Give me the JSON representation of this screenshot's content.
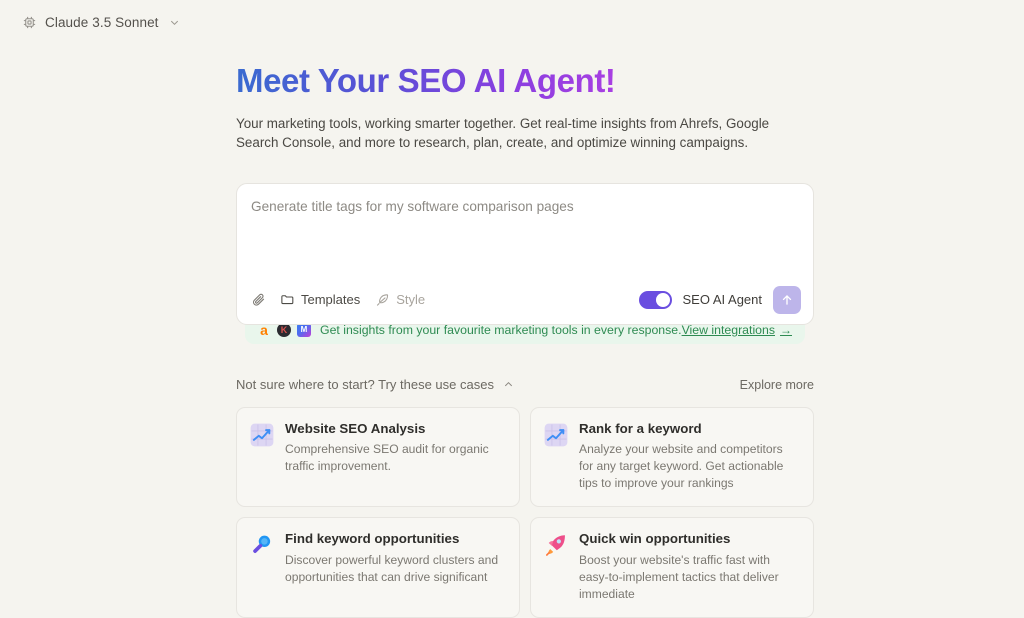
{
  "topbar": {
    "model_name": "Claude 3.5 Sonnet",
    "chip_icon": "chip-icon",
    "chevron_icon": "chevron-down-icon"
  },
  "hero": {
    "headline": "Meet Your SEO AI Agent!",
    "subtitle": "Your marketing tools, working smarter together. Get real-time insights from Ahrefs, Google Search Console, and more to research, plan, create, and optimize winning campaigns.",
    "gradient_start": "#3a6bd0",
    "gradient_end": "#a93fe2"
  },
  "composer": {
    "placeholder": "Generate title tags for my software comparison pages",
    "value": "",
    "attach_icon": "paperclip-icon",
    "templates_label": "Templates",
    "templates_icon": "folder-icon",
    "style_label": "Style",
    "style_icon": "feather-icon",
    "agent_toggle_label": "SEO AI Agent",
    "agent_toggle_on": true,
    "toggle_color": "#6a4ee0",
    "send_icon": "arrow-up-icon",
    "send_button_color": "#bdb5ea"
  },
  "integrations": {
    "text": "Get insights from your favourite marketing tools in every response.",
    "link_label": "View integrations",
    "link_arrow": "→",
    "accent_color": "#2e8b52",
    "background_color": "#e9f6ec",
    "icons": [
      {
        "name": "ahrefs-icon",
        "glyph": "a"
      },
      {
        "name": "google-search-console-icon",
        "glyph": "K"
      },
      {
        "name": "marketing-tool-icon",
        "glyph": "M"
      }
    ]
  },
  "usecases": {
    "title": "Not sure where to start? Try these use cases",
    "collapse_icon": "chevron-up-icon",
    "explore_more": "Explore more",
    "cards": [
      {
        "title": "Website SEO Analysis",
        "desc": "Comprehensive SEO audit for organic traffic improvement.",
        "icon": "chart-increasing-icon"
      },
      {
        "title": "Rank for a keyword",
        "desc": "Analyze your website and competitors for any target keyword. Get actionable tips to improve your rankings",
        "icon": "chart-increasing-icon"
      },
      {
        "title": "Find keyword opportunities",
        "desc": "Discover powerful keyword clusters and opportunities that can drive significant",
        "icon": "magnifier-icon"
      },
      {
        "title": "Quick win opportunities",
        "desc": "Boost your website's traffic fast with easy-to-implement tactics that deliver immediate",
        "icon": "rocket-icon"
      }
    ]
  }
}
